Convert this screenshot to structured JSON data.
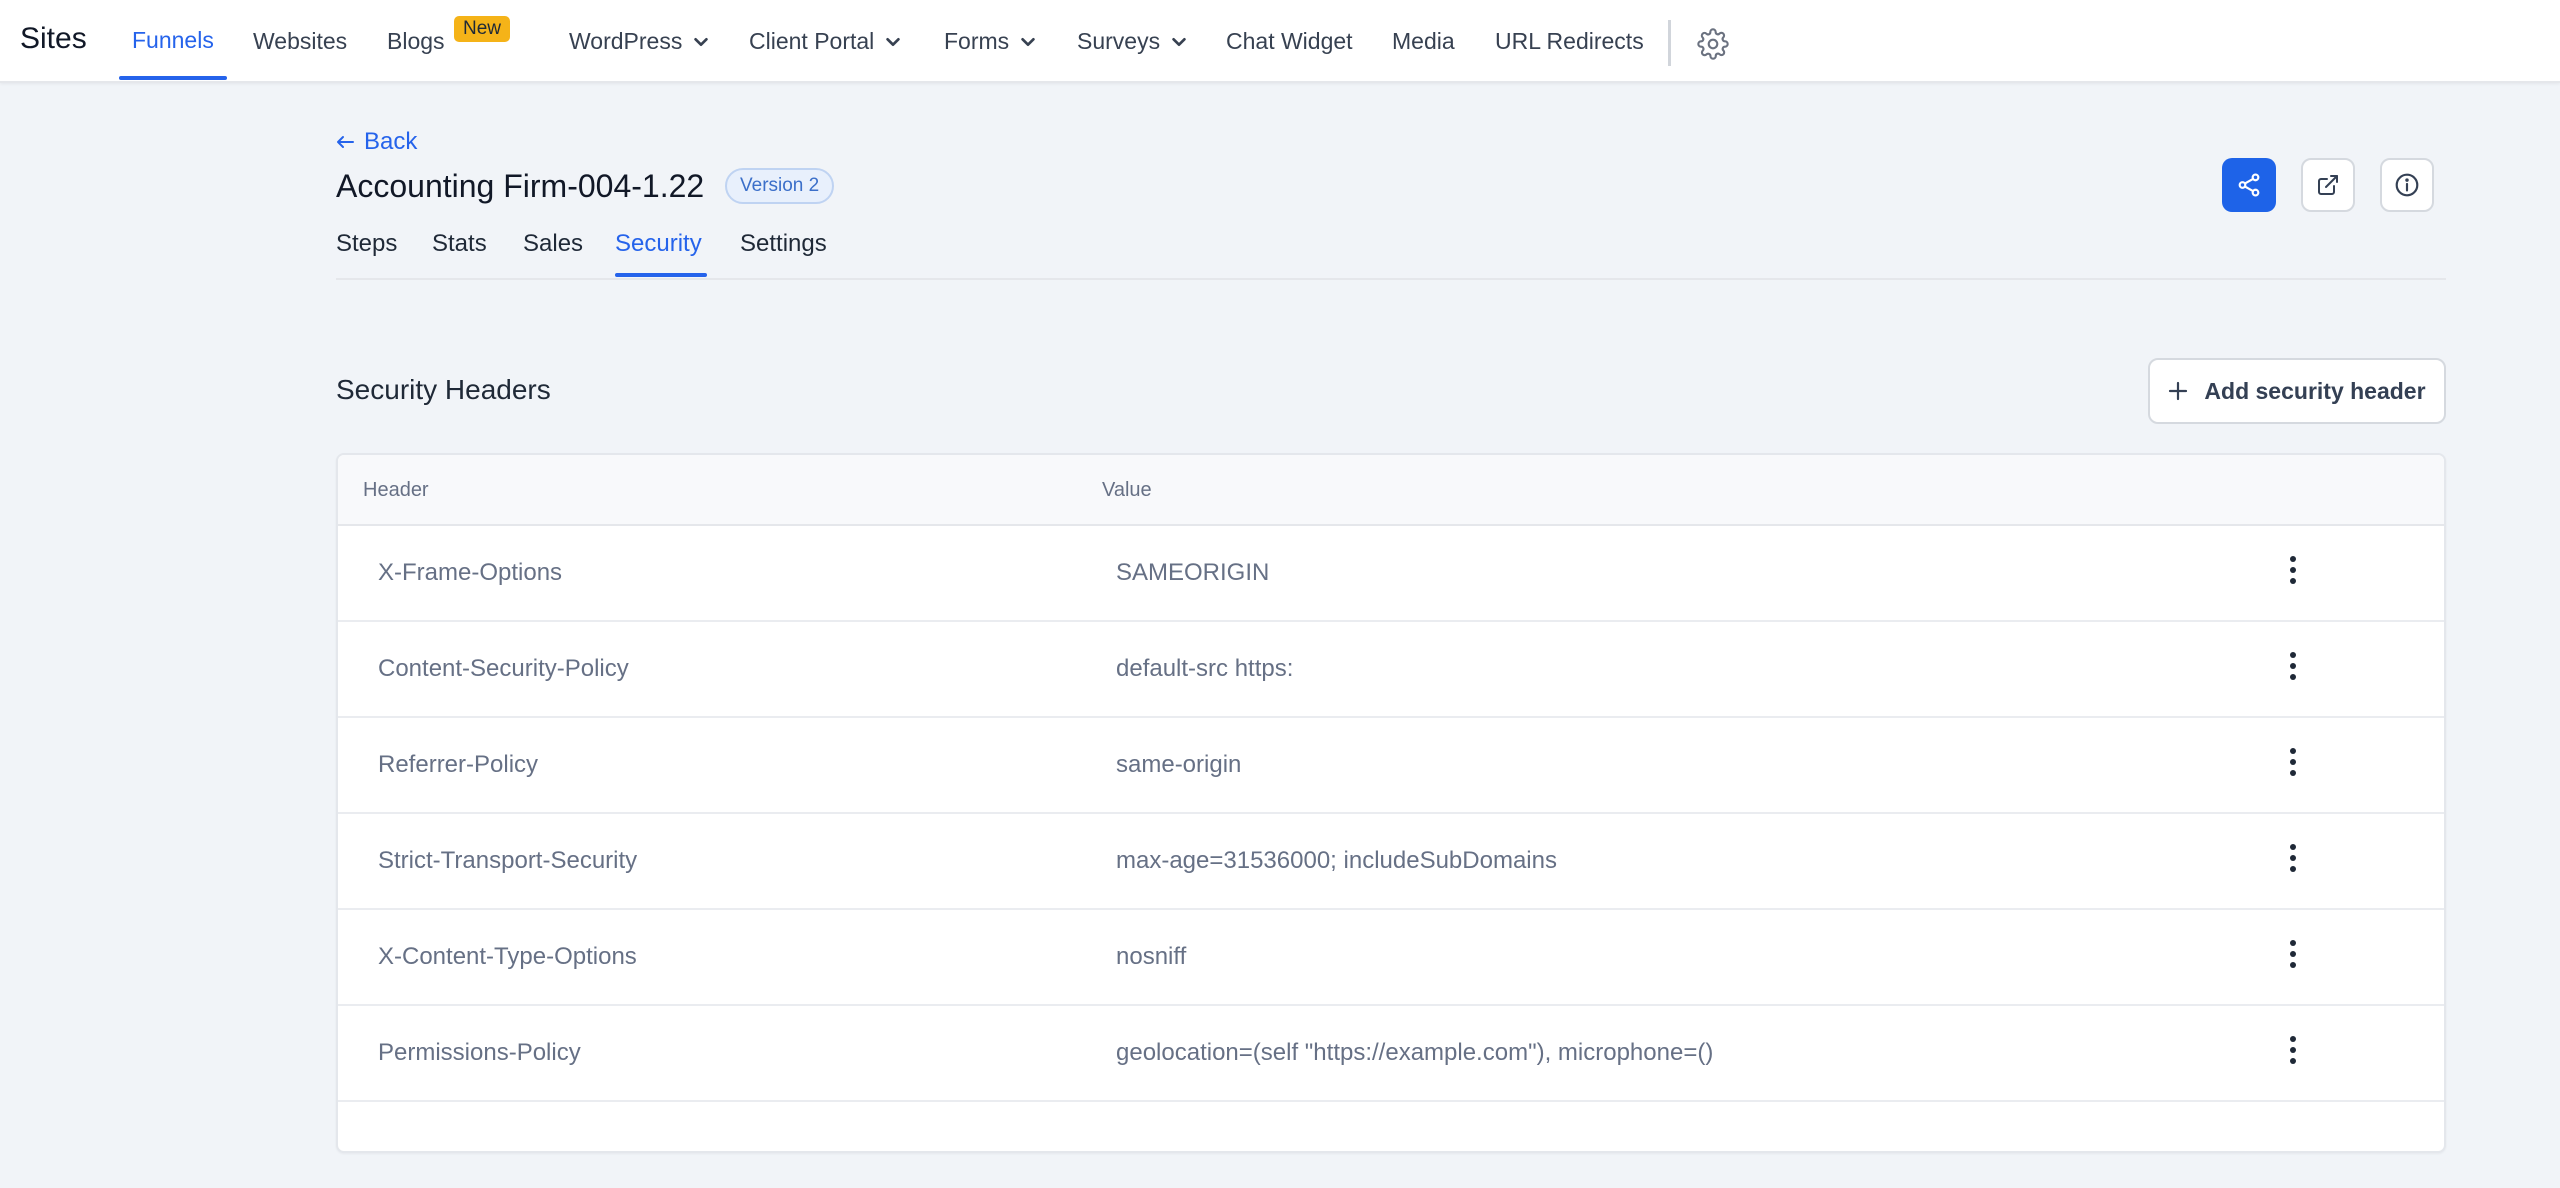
{
  "nav": {
    "brand": "Sites",
    "items": [
      {
        "label": "Funnels",
        "active": true
      },
      {
        "label": "Websites"
      },
      {
        "label": "Blogs",
        "badge": "New"
      },
      {
        "label": "WordPress",
        "dropdown": true
      },
      {
        "label": "Client Portal",
        "dropdown": true
      },
      {
        "label": "Forms",
        "dropdown": true
      },
      {
        "label": "Surveys",
        "dropdown": true
      },
      {
        "label": "Chat Widget"
      },
      {
        "label": "Media"
      },
      {
        "label": "URL Redirects"
      }
    ],
    "settings_icon": "gear-icon"
  },
  "header": {
    "back_label": "Back",
    "title": "Accounting Firm-004-1.22",
    "version_badge": "Version 2",
    "tabs": [
      {
        "label": "Steps"
      },
      {
        "label": "Stats"
      },
      {
        "label": "Sales"
      },
      {
        "label": "Security",
        "active": true
      },
      {
        "label": "Settings"
      }
    ],
    "actions": [
      "share-icon",
      "external-link-icon",
      "info-icon"
    ]
  },
  "section": {
    "title": "Security Headers",
    "add_button": "Add security header"
  },
  "table": {
    "columns": [
      "Header",
      "Value"
    ],
    "rows": [
      {
        "header": "X-Frame-Options",
        "value": "SAMEORIGIN"
      },
      {
        "header": "Content-Security-Policy",
        "value": "default-src https:"
      },
      {
        "header": "Referrer-Policy",
        "value": "same-origin"
      },
      {
        "header": "Strict-Transport-Security",
        "value": "max-age=31536000; includeSubDomains"
      },
      {
        "header": "X-Content-Type-Options",
        "value": "nosniff"
      },
      {
        "header": "Permissions-Policy",
        "value": "geolocation=(self \"https://example.com\"), microphone=()"
      }
    ]
  },
  "colors": {
    "accent": "#2563eb",
    "primary_button": "#1e63e8",
    "badge_new": "#f5b318",
    "background": "#f1f4f8"
  }
}
